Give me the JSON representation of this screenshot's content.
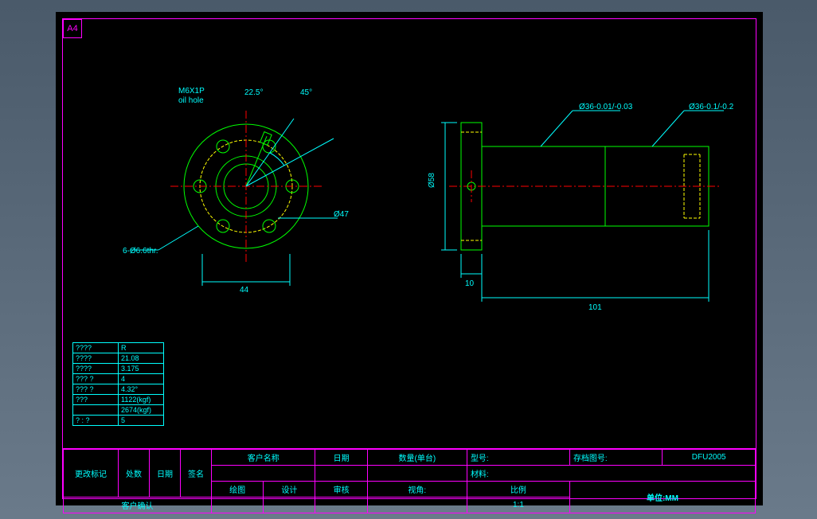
{
  "sheet": "A4",
  "front": {
    "oil_hole_label1": "M6X1P",
    "oil_hole_label2": "oil hole",
    "angle1": "22.5°",
    "angle2": "45°",
    "bolt_circle": "Ø47",
    "hole_spec": "6-Ø6.6thr.",
    "width": "44"
  },
  "side": {
    "dia1": "Ø36-0.01/-0.03",
    "dia2": "Ø36-0.1/-0.2",
    "flange_dia": "Ø58",
    "flange_thk": "10",
    "length": "101"
  },
  "spec_table": {
    "rows": [
      [
        "????",
        "R"
      ],
      [
        "????",
        "21.08"
      ],
      [
        "????",
        "3.175"
      ],
      [
        "??? ?",
        "4"
      ],
      [
        "??? ?",
        "4.32°"
      ],
      [
        "???",
        "1122(kgf)"
      ],
      [
        "",
        "2674(kgf)"
      ],
      [
        "? : ?",
        "5"
      ]
    ]
  },
  "titleblock": {
    "cust_name_h": "客户名称",
    "date_h": "日期",
    "qty_h": "数量(单台)",
    "model_h": "型号:",
    "dwgno_h": "存档图号:",
    "dwgno": "DFU2005",
    "mat_h": "材料:",
    "draw_h": "绘图",
    "design_h": "设计",
    "check_h": "审核",
    "view_h": "视角:",
    "scale_h": "比例",
    "scale": "1:1",
    "unit": "单位:MM",
    "change_h": "更改标记",
    "loc_h": "处数",
    "date2_h": "日期",
    "sign_h": "签名",
    "confirm_h": "客户确认"
  }
}
